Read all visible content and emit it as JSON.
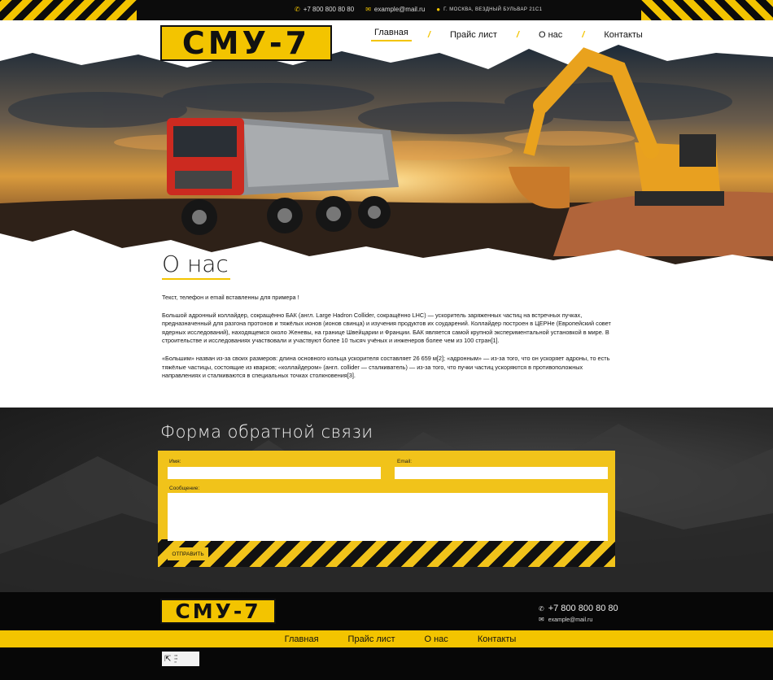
{
  "topbar": {
    "phone": "+7 800 800 80 80",
    "email": "example@mail.ru",
    "address": "г. Москва, Вездный бульвар 21с1"
  },
  "logo": {
    "text": "СМУ-7"
  },
  "nav": {
    "items": [
      "Главная",
      "Прайс лист",
      "О нас",
      "Контакты"
    ],
    "active": "Главная"
  },
  "about": {
    "title": "О нас",
    "paragraphs": [
      "Текст, телефон и email вставленны для примера !",
      "Большой адронный коллайдер, сокращённо БАК (англ. Large Hadron Collider, сокращённо LHC) — ускоритель заряженных частиц на встречных пучках, предназначенный для разгона протонов и тяжёлых ионов (ионов свинца) и изучения продуктов их соударений. Коллайдер построен в ЦЕРНе (Европейский совет ядерных исследований), находящемся около Женевы, на границе Швейцарии и Франции. БАК является самой крупной экспериментальной установкой в мире. В строительстве и исследованиях участвовали и участвуют более 10 тысяч учёных и инженеров более чем из 100 стран[1].",
      "«Большим» назван из-за своих размеров: длина основного кольца ускорителя составляет 26 659 м[2]; «адронным» — из-за того, что он ускоряет адроны, то есть тяжёлые частицы, состоящие из кварков; «коллайдером» (англ. collider — сталкиватель) — из-за того, что пучки частиц ускоряются в противоположных направлениях и сталкиваются в специальных точках столкновения[3]."
    ]
  },
  "feedback": {
    "title": "Форма обратной связи",
    "name_label": "Имя:",
    "email_label": "Email:",
    "message_label": "Сообщение:",
    "name_value": "",
    "email_value": "",
    "message_value": "",
    "submit_label": "ОТПРАВИТЬ"
  },
  "footer": {
    "logo_text": "СМУ-7",
    "phone": "+7 800 800 80 80",
    "email": "example@mail.ru",
    "nav": [
      "Главная",
      "Прайс лист",
      "О нас",
      "Контакты"
    ]
  },
  "colors": {
    "accent": "#f3c400",
    "dark": "#0c0c0c"
  },
  "icons": {
    "phone": "phone-icon",
    "email": "envelope-icon",
    "address": "map-pin-icon",
    "badge": "arrow-icon"
  }
}
